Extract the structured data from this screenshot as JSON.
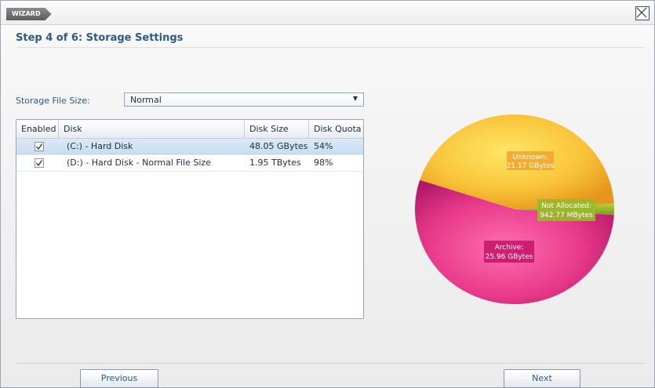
{
  "window": {
    "tag": "WIZARD",
    "step_title": "Step 4 of 6: Storage Settings"
  },
  "storage_file_size": {
    "label": "Storage File Size:",
    "value": "Normal"
  },
  "table": {
    "columns": [
      "Enabled",
      "Disk",
      "Disk Size",
      "Disk Quota"
    ],
    "rows": [
      {
        "enabled": true,
        "disk": "(C:) - Hard Disk",
        "disk_size": "48.05 GBytes",
        "disk_quota": "54%"
      },
      {
        "enabled": true,
        "disk": "(D:) - Hard Disk - Normal File Size",
        "disk_size": "1.95 TBytes",
        "disk_quota": "98%"
      }
    ]
  },
  "chart_data": {
    "type": "pie",
    "slices": [
      {
        "label": "Unknown:",
        "value_text": "21.17 GBytes",
        "value_gb": 21.17,
        "color": "#f5b82e"
      },
      {
        "label": "Not Allocated:",
        "value_text": "942.77 MBytes",
        "value_gb": 0.92,
        "color": "#9bb72a"
      },
      {
        "label": "Archive:",
        "value_text": "25.96 GBytes",
        "value_gb": 25.96,
        "color": "#e2337f"
      }
    ]
  },
  "buttons": {
    "previous": "Previous",
    "next": "Next"
  },
  "colors": {
    "accent": "#2c5a84",
    "selected_row": "#cfe1f3"
  }
}
